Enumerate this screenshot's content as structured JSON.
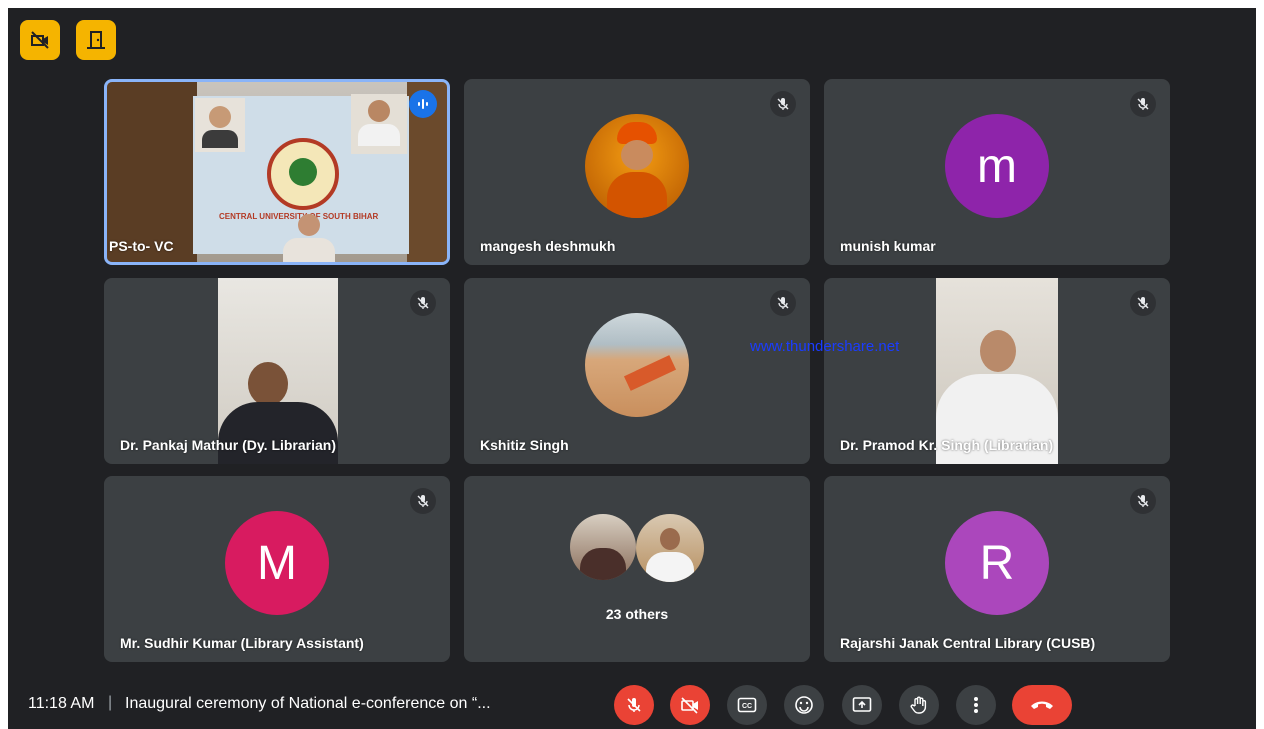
{
  "toolbar_icons": [
    "no-camera-icon",
    "door-exit-icon"
  ],
  "tiles": [
    {
      "name": "PS-to- VC",
      "speaking_icon": "audio-level-icon"
    },
    {
      "name": "mangesh deshmukh",
      "muted": true
    },
    {
      "name": "munish kumar",
      "initial": "m",
      "color": "#8e24aa",
      "muted": true
    },
    {
      "name": "Dr. Pankaj Mathur (Dy. Librarian)",
      "muted": true
    },
    {
      "name": "Kshitiz Singh",
      "muted": true
    },
    {
      "name": "Dr. Pramod Kr. Singh (Librarian)",
      "muted": true
    },
    {
      "name": "Mr. Sudhir Kumar (Library Assistant)",
      "initial": "M",
      "color": "#d81b60",
      "muted": true
    },
    {
      "name": "23 others"
    },
    {
      "name": "Rajarshi Janak Central Library (CUSB)",
      "initial": "R",
      "color": "#ab47bc",
      "muted": true
    }
  ],
  "banner_text": "CENTRAL UNIVERSITY OF SOUTH BIHAR",
  "watermark": "www.thundershare.net",
  "bottom_bar": {
    "time": "11:18 AM",
    "separator": "|",
    "meeting_title": "Inaugural ceremony of National e-conference on “..."
  },
  "controls": [
    "mic-off-icon",
    "camera-off-icon",
    "captions-icon",
    "emoji-icon",
    "present-icon",
    "raise-hand-icon",
    "more-icon",
    "end-call-icon"
  ],
  "colors": {
    "accent": "#8ab4f8",
    "danger": "#ea4335",
    "warning": "#f5b400",
    "tile_bg": "#3c4043",
    "app_bg": "#202124"
  }
}
